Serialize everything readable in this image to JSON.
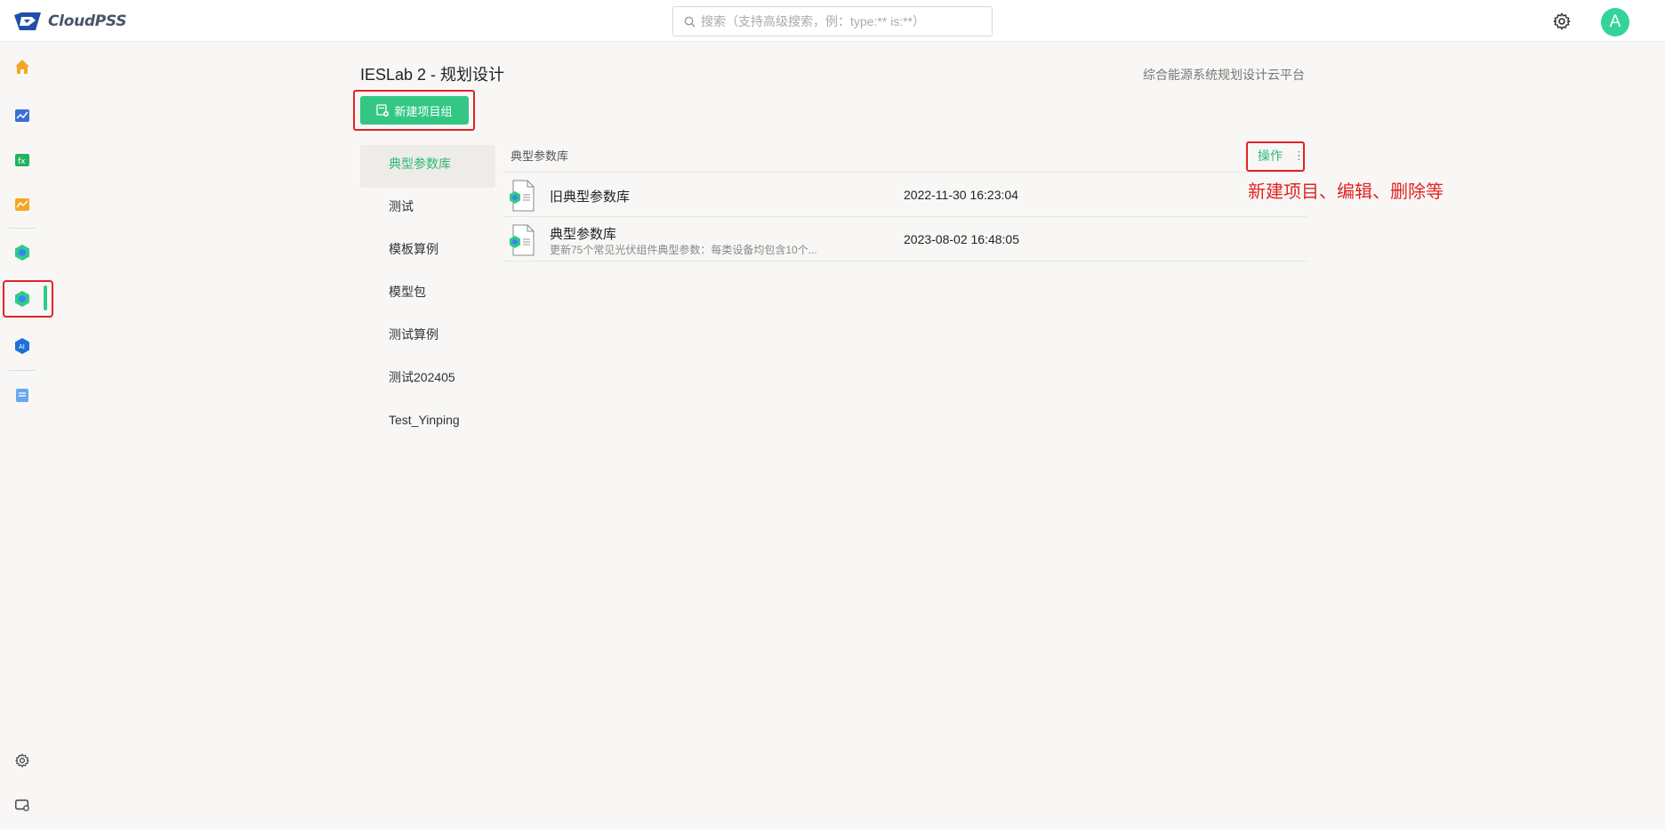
{
  "app": {
    "brand": "CloudPSS"
  },
  "search": {
    "placeholder": "搜索（支持高级搜索，例：type:** is:**）"
  },
  "user": {
    "avatar_letter": "A"
  },
  "page": {
    "title": "IESLab 2 - 规划设计",
    "subtitle": "综合能源系统规划设计云平台",
    "new_group_button": "新建项目组"
  },
  "groups": [
    {
      "label": "典型参数库",
      "active": true
    },
    {
      "label": "测试"
    },
    {
      "label": "模板算例"
    },
    {
      "label": "模型包"
    },
    {
      "label": "测试算例"
    },
    {
      "label": "测试202405"
    },
    {
      "label": "Test_Yinping"
    }
  ],
  "table": {
    "header_title": "典型参数库",
    "operation_label": "操作",
    "operation_dots": "⋮",
    "rows": [
      {
        "name": "旧典型参数库",
        "description": "",
        "date": "2022-11-30 16:23:04"
      },
      {
        "name": "典型参数库",
        "description": "更新75个常见光伏组件典型参数：每类设备均包含10个...",
        "date": "2023-08-02 16:48:05"
      }
    ]
  },
  "annotation": {
    "text": "新建项目、编辑、删除等"
  },
  "colors": {
    "accent": "#34c783",
    "highlight": "#e02424",
    "avatar": "#34d399"
  },
  "rail_icons": [
    "home-icon",
    "chart-app-icon",
    "function-app-icon",
    "trend-app-icon",
    "ieslab-app-icon",
    "ieslab-planning-icon",
    "ai-app-icon",
    "document-icon",
    "settings-icon",
    "device-settings-icon"
  ]
}
